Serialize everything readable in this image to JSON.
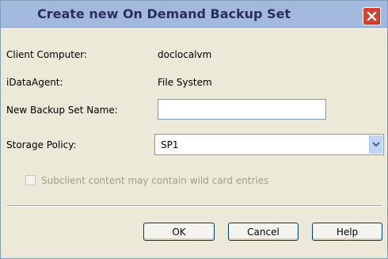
{
  "dialog": {
    "title": "Create new On Demand Backup Set",
    "close_icon": "close-icon"
  },
  "fields": {
    "client_computer_label": "Client Computer:",
    "client_computer_value": "doclocalvm",
    "idataagent_label": "iDataAgent:",
    "idataagent_value": "File System",
    "backup_set_name_label": "New Backup Set Name:",
    "backup_set_name_value": "",
    "storage_policy_label": "Storage Policy:",
    "storage_policy_value": "SP1",
    "dropdown_icon": "chevron-down-icon"
  },
  "options": {
    "wildcard_label": "Subclient content may contain wild card entries",
    "wildcard_checked": false
  },
  "buttons": {
    "ok": "OK",
    "cancel": "Cancel",
    "help": "Help"
  },
  "colors": {
    "title_bar": "#a3b8dd",
    "title_text": "#2a2f5e",
    "close_button": "#d5402f",
    "dialog_background": "#ece9d8",
    "disabled_text": "#a19f94"
  }
}
